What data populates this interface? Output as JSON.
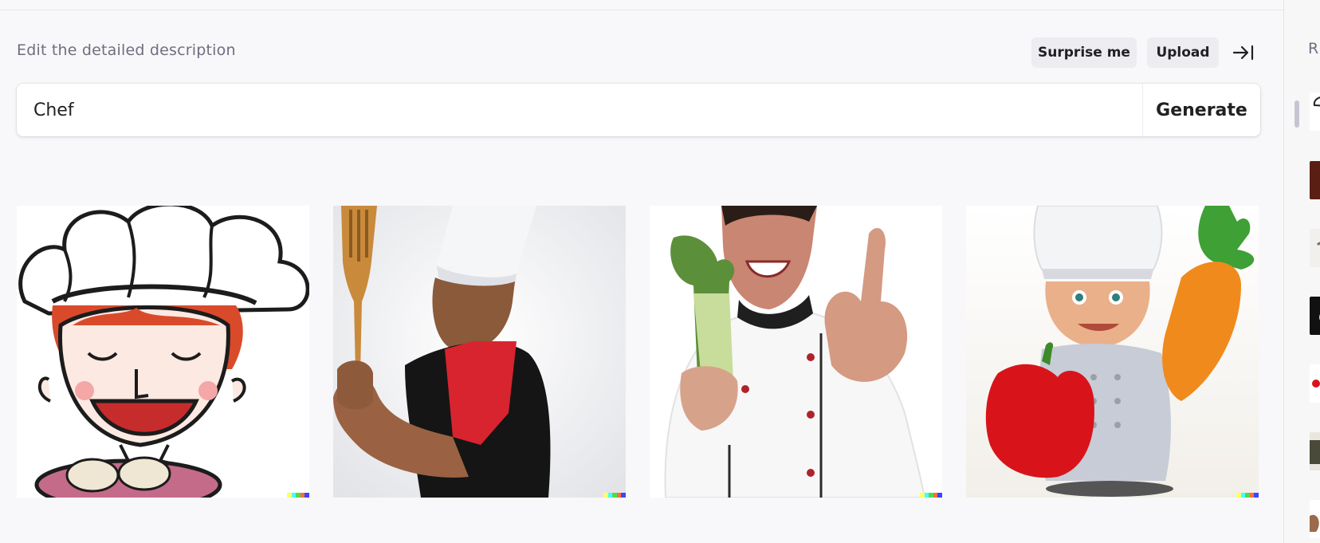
{
  "header": {
    "helper_label": "Edit the detailed description",
    "surprise_label": "Surprise me",
    "upload_label": "Upload",
    "collapse_icon": "collapse-right-icon"
  },
  "prompt": {
    "value": "Chef",
    "generate_label": "Generate"
  },
  "gallery": {
    "images": [
      "cartoon-chef-with-bowl",
      "chef-holding-wooden-spatula",
      "chef-with-celery-thumbs-up",
      "3d-chef-with-pepper-and-carrot"
    ],
    "signature_colors": [
      "#ffff66",
      "#42ffff",
      "#51da4c",
      "#ff6e3c",
      "#3c46ff"
    ]
  },
  "history": {
    "title_partial": "R"
  },
  "colors": {
    "background": "#f8f8fa",
    "button": "#ececf1",
    "text": "#202123",
    "muted": "#6e6e80"
  }
}
